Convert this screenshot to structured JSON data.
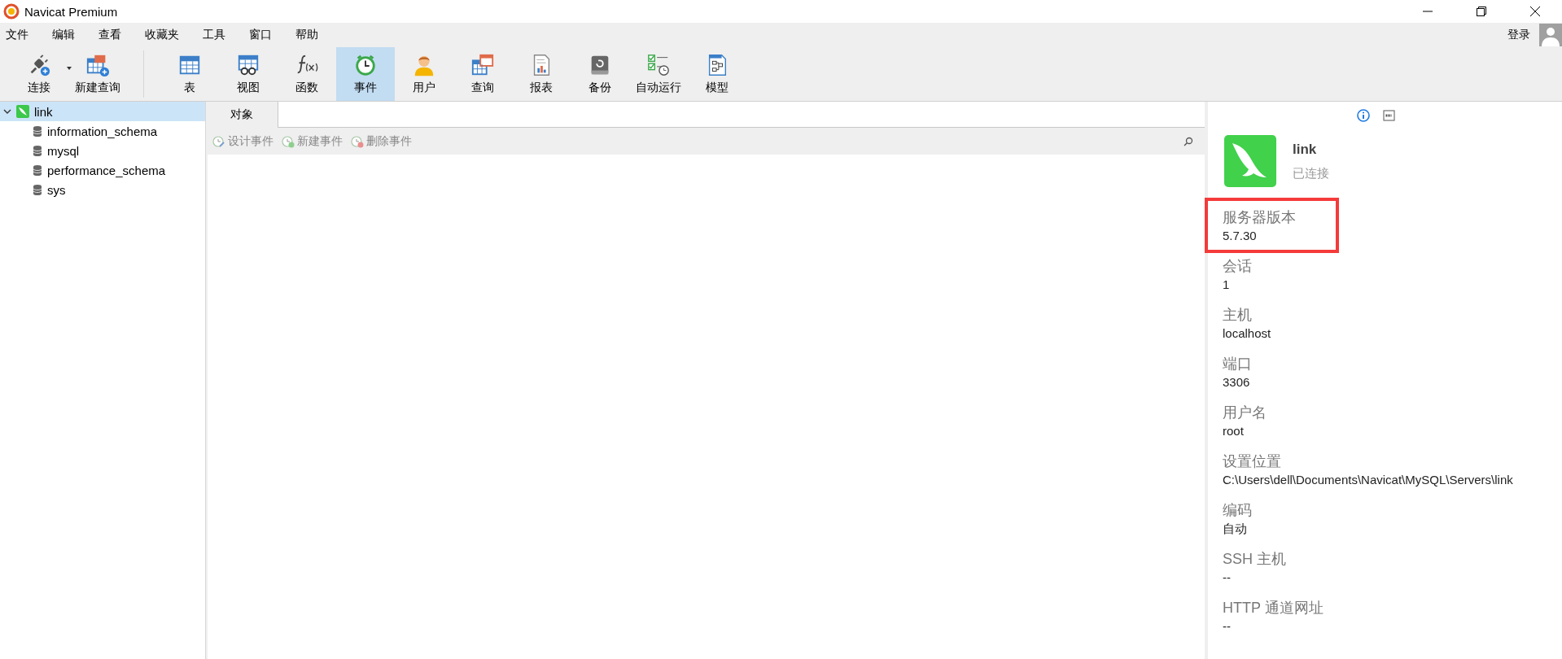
{
  "window": {
    "title": "Navicat Premium"
  },
  "menu": [
    "文件",
    "编辑",
    "查看",
    "收藏夹",
    "工具",
    "窗口",
    "帮助"
  ],
  "login": "登录",
  "toolbar": [
    {
      "label": "连接",
      "selected": false,
      "dropdown": true
    },
    {
      "label": "新建查询",
      "selected": false,
      "dropdown": false
    },
    {
      "label": "表",
      "selected": false,
      "dropdown": false
    },
    {
      "label": "视图",
      "selected": false,
      "dropdown": false
    },
    {
      "label": "函数",
      "selected": false,
      "dropdown": false
    },
    {
      "label": "事件",
      "selected": true,
      "dropdown": false
    },
    {
      "label": "用户",
      "selected": false,
      "dropdown": false
    },
    {
      "label": "查询",
      "selected": false,
      "dropdown": false
    },
    {
      "label": "报表",
      "selected": false,
      "dropdown": false
    },
    {
      "label": "备份",
      "selected": false,
      "dropdown": false
    },
    {
      "label": "自动运行",
      "selected": false,
      "dropdown": false
    },
    {
      "label": "模型",
      "selected": false,
      "dropdown": false
    }
  ],
  "sidebar": {
    "items": [
      {
        "label": "link",
        "selected": true,
        "expanded": true,
        "children": [
          {
            "label": "information_schema",
            "selected": false
          },
          {
            "label": "mysql",
            "selected": false
          },
          {
            "label": "performance_schema",
            "selected": false
          },
          {
            "label": "sys",
            "selected": false
          }
        ]
      }
    ]
  },
  "tabs": [
    {
      "label": "对象",
      "selected": true
    }
  ],
  "object_toolbar": [
    {
      "label": "设计事件",
      "kind": "design"
    },
    {
      "label": "新建事件",
      "kind": "new"
    },
    {
      "label": "删除事件",
      "kind": "delete"
    }
  ],
  "info_panel": {
    "name": "link",
    "status": "已连接",
    "fields": [
      {
        "label": "服务器版本",
        "value": "5.7.30",
        "highlighted": true
      },
      {
        "label": "会话",
        "value": "1",
        "highlighted": false
      },
      {
        "label": "主机",
        "value": "localhost",
        "highlighted": false
      },
      {
        "label": "端口",
        "value": "3306",
        "highlighted": false
      },
      {
        "label": "用户名",
        "value": "root",
        "highlighted": false
      },
      {
        "label": "设置位置",
        "value": "C:\\Users\\dell\\Documents\\Navicat\\MySQL\\Servers\\link",
        "highlighted": false
      },
      {
        "label": "编码",
        "value": "自动",
        "highlighted": false
      },
      {
        "label": "SSH 主机",
        "value": "--",
        "highlighted": false
      },
      {
        "label": "HTTP 通道网址",
        "value": "--",
        "highlighted": false
      }
    ]
  }
}
